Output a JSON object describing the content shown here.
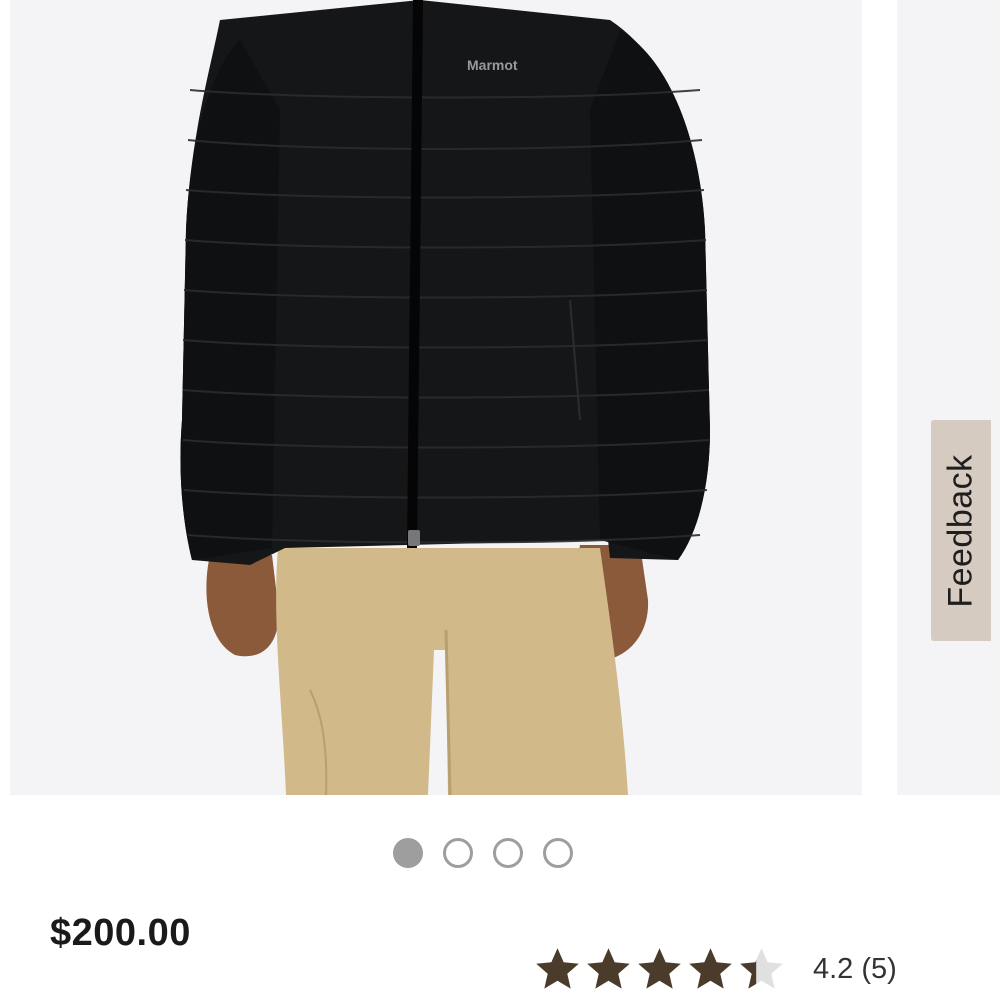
{
  "product": {
    "brand_logo_text": "Marmot",
    "price": "$200.00",
    "rating_value": 4.2,
    "rating_max": 5,
    "rating_text": "4.2 (5)"
  },
  "gallery": {
    "slide_count": 4,
    "active_index": 0
  },
  "feedback": {
    "label": "Feedback"
  },
  "colors": {
    "jacket": "#141618",
    "pants": "#d1b98a",
    "skin": "#8a5a3b",
    "star_filled": "#4a3b2b",
    "star_empty": "#e0e0e0",
    "feedback_bg": "#d6cbc1",
    "dot": "#9e9e9e"
  },
  "icons": {
    "star": "star-icon"
  }
}
